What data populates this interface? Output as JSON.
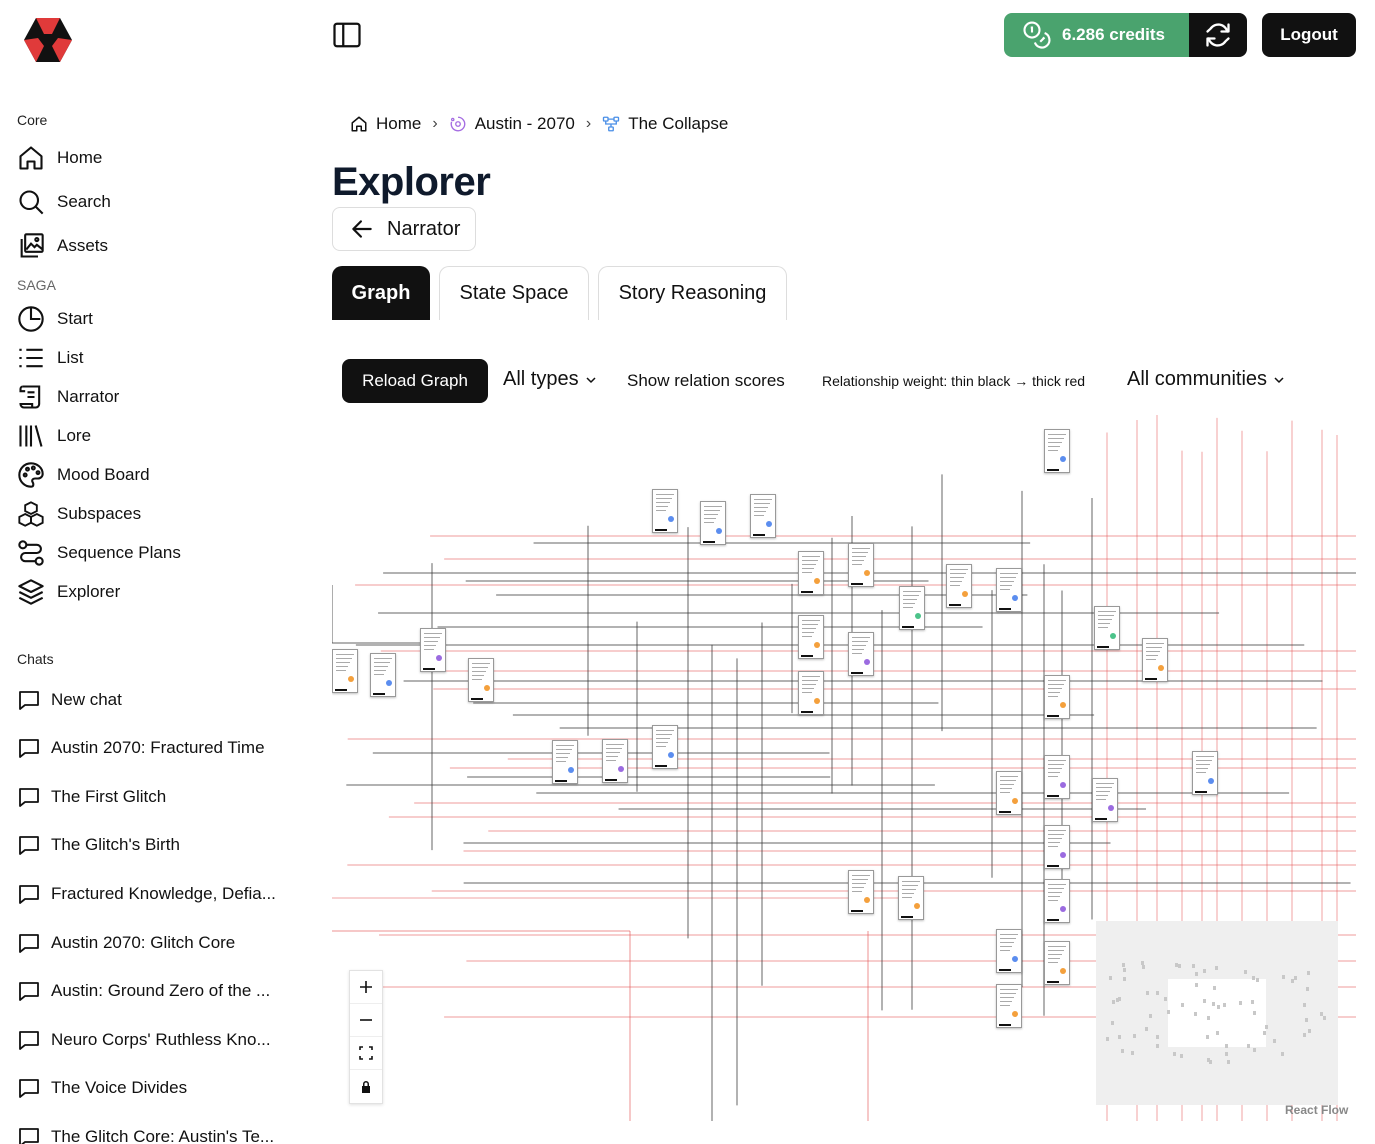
{
  "header": {
    "credits": "6.286 credits",
    "logout_label": "Logout"
  },
  "sidebar": {
    "core_label": "Core",
    "core_items": [
      {
        "label": "Home",
        "icon": "home-icon"
      },
      {
        "label": "Search",
        "icon": "search-icon"
      },
      {
        "label": "Assets",
        "icon": "assets-icon"
      }
    ],
    "saga_label": "SAGA",
    "saga_items": [
      {
        "label": "Start",
        "icon": "clock-icon"
      },
      {
        "label": "List",
        "icon": "list-icon"
      },
      {
        "label": "Narrator",
        "icon": "scroll-icon"
      },
      {
        "label": "Lore",
        "icon": "library-icon"
      },
      {
        "label": "Mood Board",
        "icon": "palette-icon"
      },
      {
        "label": "Subspaces",
        "icon": "cubes-icon"
      },
      {
        "label": "Sequence Plans",
        "icon": "route-icon"
      },
      {
        "label": "Explorer",
        "icon": "layers-icon"
      }
    ],
    "chats_label": "Chats",
    "chats": [
      "New chat",
      "Austin 2070: Fractured Time",
      "The First Glitch",
      "The Glitch's Birth",
      "Fractured Knowledge, Defia...",
      "Austin 2070: Glitch Core",
      "Austin: Ground Zero of the ...",
      "Neuro Corps' Ruthless Kno...",
      "The Voice Divides",
      "The Glitch Core: Austin's Te..."
    ]
  },
  "breadcrumb": {
    "home": "Home",
    "saga": "Austin - 2070",
    "current": "The Collapse"
  },
  "page": {
    "title": "Explorer",
    "back_label": "Narrator"
  },
  "tabs": [
    "Graph",
    "State Space",
    "Story Reasoning"
  ],
  "toolbar": {
    "reload_label": "Reload Graph",
    "types_label": "All types",
    "scores_label": "Show relation scores",
    "legend": "Relationship weight: thin black → thick red",
    "communities_label": "All communities"
  },
  "graph": {
    "attribution": "React Flow",
    "colors": {
      "blue": "#5b8def",
      "orange": "#f4a03c",
      "purple": "#9b6be0",
      "green": "#4cc38a",
      "red_edge": "#e24a4a",
      "black_edge": "#333333"
    }
  }
}
